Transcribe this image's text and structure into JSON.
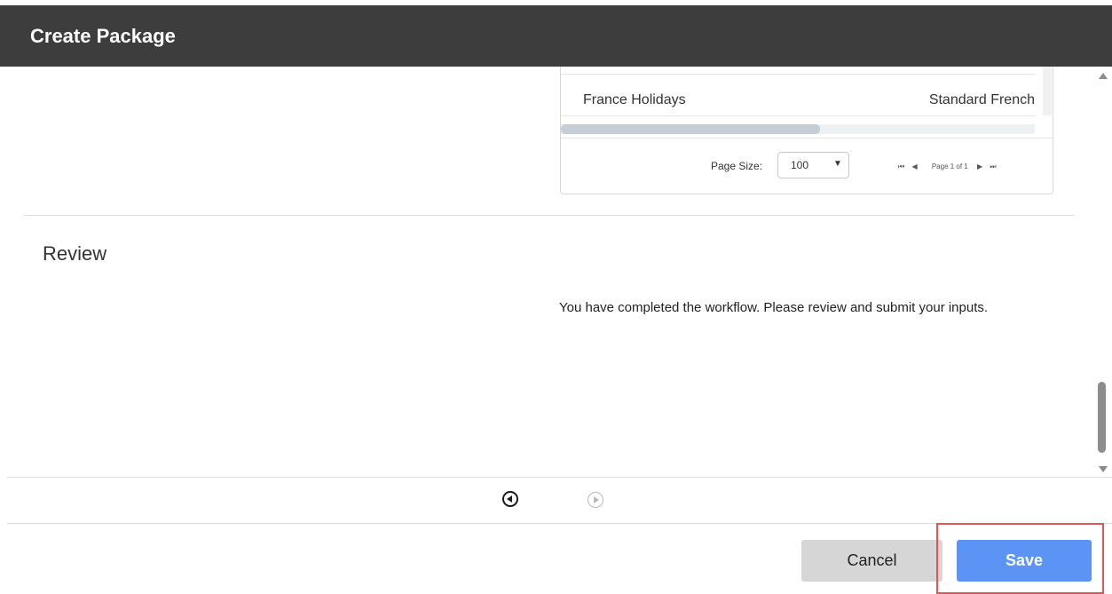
{
  "dialog": {
    "title": "Create Package"
  },
  "grid": {
    "rows": [
      {
        "name": "France Holidays",
        "language": "Standard French"
      }
    ],
    "pagination": {
      "page_size_label": "Page Size:",
      "page_size_value": "100",
      "page_text": "Page 1 of 1"
    }
  },
  "review": {
    "title": "Review",
    "message": "You have completed the workflow. Please review and submit your inputs."
  },
  "footer": {
    "cancel_label": "Cancel",
    "save_label": "Save"
  },
  "colors": {
    "header_bg": "#3d3d3d",
    "save_button": "#5b94f5",
    "cancel_button": "#d6d6d6",
    "highlight": "#e05555"
  }
}
